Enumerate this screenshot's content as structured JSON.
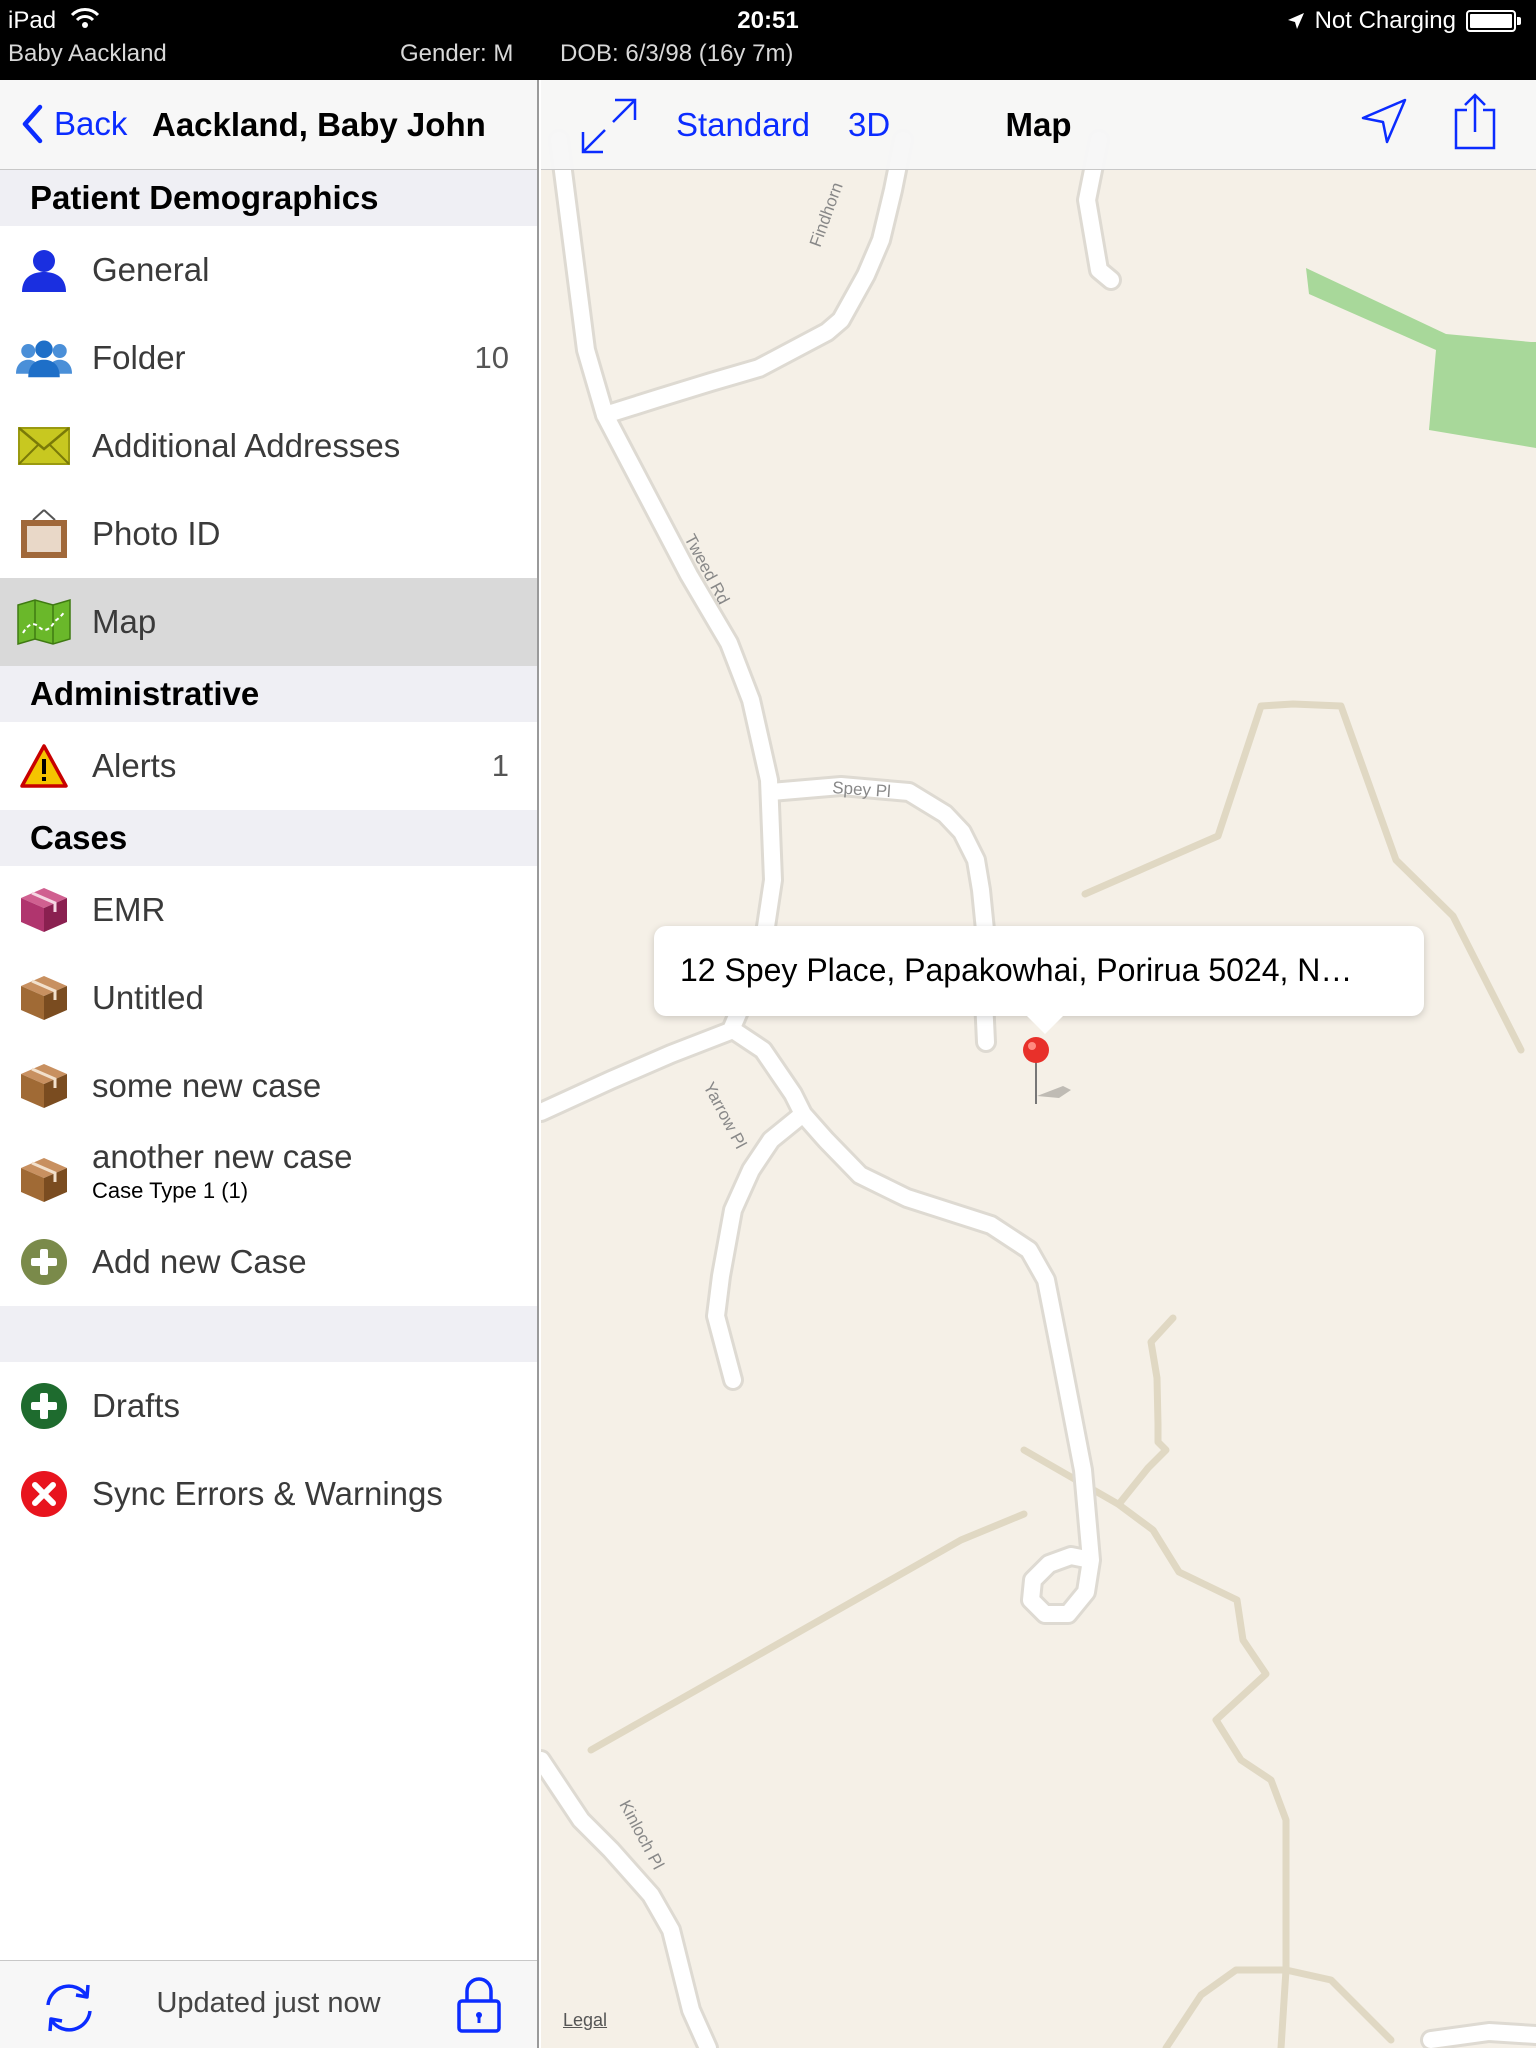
{
  "statusbar": {
    "device": "iPad",
    "time": "20:51",
    "charging": "Not Charging",
    "patient": "Baby Aackland",
    "gender": "Gender: M",
    "dob": "DOB: 6/3/98 (16y 7m)"
  },
  "navbar": {
    "back_label": "Back",
    "title": "Aackland, Baby John"
  },
  "sections": {
    "demographics": "Patient Demographics",
    "administrative": "Administrative",
    "cases": "Cases"
  },
  "menu": {
    "general": {
      "label": "General",
      "icon": "person-icon"
    },
    "folder": {
      "label": "Folder",
      "count": "10",
      "icon": "group-icon"
    },
    "addresses": {
      "label": "Additional Addresses",
      "icon": "envelope-icon"
    },
    "photo": {
      "label": "Photo ID",
      "icon": "photo-frame-icon"
    },
    "map": {
      "label": "Map",
      "icon": "map-icon",
      "selected": true
    },
    "alerts": {
      "label": "Alerts",
      "count": "1",
      "icon": "warning-icon"
    },
    "emr": {
      "label": "EMR",
      "icon": "box-icon",
      "color": "#b0356e"
    },
    "untitled": {
      "label": "Untitled",
      "icon": "box-icon",
      "color": "#a06a35"
    },
    "somecase": {
      "label": "some new case",
      "icon": "box-icon",
      "color": "#a06a35"
    },
    "anothercase": {
      "label": "another new case",
      "sublabel": "Case Type 1 (1)",
      "icon": "box-icon",
      "color": "#a06a35"
    },
    "addcase": {
      "label": "Add new Case",
      "icon": "plus-circle-icon",
      "color": "#7a8a4a"
    },
    "drafts": {
      "label": "Drafts",
      "icon": "plus-circle-icon",
      "color": "#1e6b2e"
    },
    "sync": {
      "label": "Sync Errors & Warnings",
      "icon": "x-circle-icon",
      "color": "#e8141e"
    }
  },
  "footer": {
    "updated": "Updated just now"
  },
  "map": {
    "standard_label": "Standard",
    "three_d_label": "3D",
    "title": "Map",
    "callout": "12 Spey Place, Papakowhai, Porirua 5024, N…",
    "legal": "Legal",
    "roads": {
      "findhorn": "Findhorn",
      "tweed": "Tweed Rd",
      "spey": "Spey Pl",
      "yarrow": "Yarrow Pl",
      "kinloch": "Kinloch Pl"
    }
  },
  "colors": {
    "accent": "#0b2cff",
    "map_bg": "#f5f0e7",
    "park": "#a8d89a",
    "pin": "#e8302a"
  }
}
